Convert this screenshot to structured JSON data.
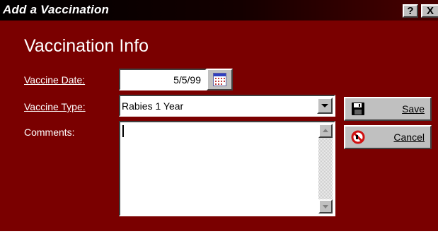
{
  "window": {
    "title": "Add a Vaccination",
    "help_label": "?",
    "close_label": "X"
  },
  "form": {
    "heading": "Vaccination Info",
    "vaccine_date_label": "Vaccine Date:",
    "vaccine_date_value": "5/5/99",
    "vaccine_type_label": "Vaccine Type:",
    "vaccine_type_value": "Rabies 1 Year",
    "comments_label": "Comments:",
    "comments_value": ""
  },
  "buttons": {
    "save_label": "Save",
    "cancel_label": "Cancel"
  },
  "icons": {
    "calendar": "calendar-icon",
    "save": "floppy-disk-icon",
    "cancel": "cancel-icon"
  },
  "colors": {
    "window_background": "#7a0000",
    "title_bar": "#000000",
    "control_face": "#c0c0c0"
  }
}
